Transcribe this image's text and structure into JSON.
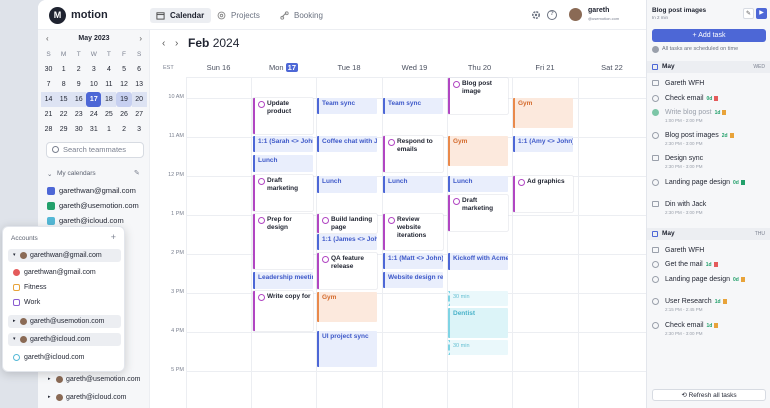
{
  "app": {
    "brand": "motion"
  },
  "nav": {
    "calendar": "Calendar",
    "projects": "Projects",
    "booking": "Booking"
  },
  "user": {
    "name": "gareth",
    "email": "@usemotion.com"
  },
  "mini_cal": {
    "title": "May 2023",
    "dow": [
      "S",
      "M",
      "T",
      "W",
      "T",
      "F",
      "S"
    ],
    "weeks": [
      [
        "30",
        "1",
        "2",
        "3",
        "4",
        "5",
        "6"
      ],
      [
        "7",
        "8",
        "9",
        "10",
        "11",
        "12",
        "13"
      ],
      [
        "14",
        "15",
        "16",
        "17",
        "18",
        "19",
        "20"
      ],
      [
        "21",
        "22",
        "23",
        "24",
        "25",
        "26",
        "27"
      ],
      [
        "28",
        "29",
        "30",
        "31",
        "1",
        "2",
        "3"
      ]
    ]
  },
  "sidebar": {
    "search_placeholder": "Search teammates",
    "my_calendars": "My calendars",
    "calendars": [
      "garethwan@gmail.com",
      "gareth@usemotion.com",
      "gareth@icloud.com"
    ],
    "calendar_colors": [
      "#4d67d6",
      "#22a06b",
      "#54b8d6"
    ],
    "more": [
      "gareth@usemotion.com",
      "gareth@icloud.com"
    ]
  },
  "popover": {
    "title": "Accounts",
    "groups": [
      {
        "account": "garethwan@gmail.com",
        "items": [
          "garethwan@gmail.com",
          "Fitness",
          "Work"
        ]
      },
      {
        "account": "gareth@usemotion.com",
        "items": []
      },
      {
        "account": "gareth@icloud.com",
        "items": [
          "gareth@icloud.com"
        ]
      }
    ]
  },
  "calendar": {
    "month": "Feb",
    "year": "2024",
    "tz": "EST",
    "days": [
      "Sun 16",
      "Mon",
      "Tue 18",
      "Wed 19",
      "Thu 20",
      "Fri 21",
      "Sat 22"
    ],
    "today_num": "17",
    "times": [
      "10 AM",
      "11 AM",
      "12 PM",
      "1 PM",
      "2 PM",
      "3 PM",
      "4 PM",
      "5 PM"
    ],
    "events": {
      "e1": "Update product",
      "e2": "Team sync",
      "e3": "Team sync",
      "e4": "Blog post image",
      "e5": "Gym",
      "e6": "1:1 (Sarah <> John)",
      "e7": "Coffee chat with J",
      "e8": "Respond to emails",
      "e9": "Gym",
      "e10": "1:1 (Amy <> John)",
      "e11": "Lunch",
      "e12": "Draft marketing",
      "e13": "Lunch",
      "e14": "Lunch",
      "e15": "Lunch",
      "e16": "Ad graphics",
      "e17": "Draft marketing",
      "e18": "Prep for design",
      "e19": "Build landing page",
      "e20": "Review website iterations",
      "e21": "1:1 (James <> John)",
      "e22": "QA feature release",
      "e23": "1:1 (Matt <> John)",
      "e24": "Kickoff with Acme",
      "e25": "Leadership meeting",
      "e26": "Website design review",
      "e27": "Write copy for",
      "e28": "Gym",
      "e29": "30 min",
      "e30": "Dentist",
      "e31": "UI project sync",
      "e32": "30 min"
    }
  },
  "tasks": {
    "header_title": "Blog post images",
    "header_sub": "In 2 min",
    "add_label": "Add task",
    "status_note": "All tasks are scheduled on time",
    "sections": [
      {
        "label": "May",
        "weekday": "WED"
      },
      {
        "label": "May",
        "weekday": "THU"
      }
    ],
    "items": [
      {
        "title": "Gareth WFH",
        "meta": ""
      },
      {
        "title": "Check email",
        "meta": "",
        "badge": "0d"
      },
      {
        "title": "Write blog post",
        "meta": "1:00 PM - 2:00 PM",
        "badge": "1d"
      },
      {
        "title": "Blog post images",
        "meta": "2:30 PM - 3:00 PM",
        "badge": "2d"
      },
      {
        "title": "Design sync",
        "meta": "2:30 PM - 3:00 PM"
      },
      {
        "title": "Landing page design",
        "meta": "",
        "badge": "0d"
      },
      {
        "title": "Din with Jack",
        "meta": "2:30 PM - 3:00 PM"
      },
      {
        "title": "Gareth WFH",
        "meta": ""
      },
      {
        "title": "Get the mail",
        "meta": "",
        "badge": "1d"
      },
      {
        "title": "Landing page design",
        "meta": "",
        "badge": "0d"
      },
      {
        "title": "User Research",
        "meta": "2:15 PM - 2:45 PM",
        "badge": "1d"
      },
      {
        "title": "Check email",
        "meta": "2:30 PM - 3:00 PM",
        "badge": "1d"
      }
    ],
    "refresh_label": "Refresh all tasks"
  }
}
